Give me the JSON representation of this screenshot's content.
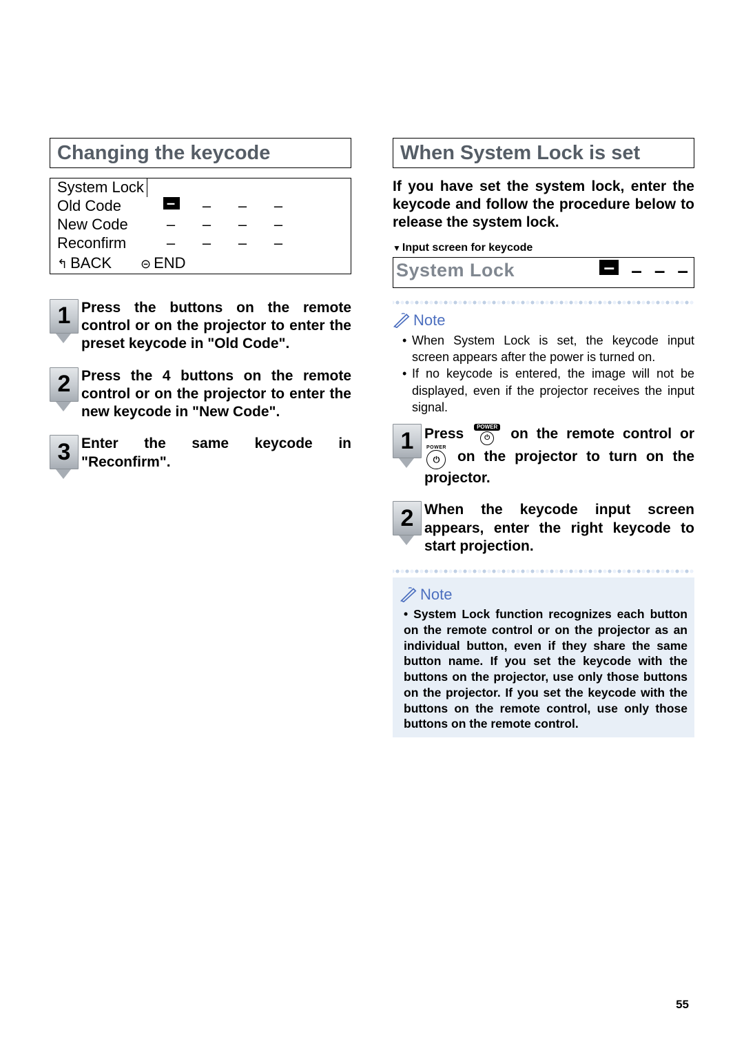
{
  "page_number": "55",
  "left": {
    "heading": "Changing the keycode",
    "osd": {
      "title": "System Lock",
      "rows": [
        {
          "label": "Old Code",
          "dashes": [
            "cursor",
            "–",
            "–",
            "–"
          ]
        },
        {
          "label": "New Code",
          "dashes": [
            "–",
            "–",
            "–",
            "–"
          ]
        },
        {
          "label": "Reconfirm",
          "dashes": [
            "–",
            "–",
            "–",
            "–"
          ]
        }
      ],
      "footer": {
        "back": "BACK",
        "end": "END"
      }
    },
    "steps": [
      {
        "n": "1",
        "text": "Press the buttons on the remote control or on the projector to enter the preset keycode in \"Old Code\"."
      },
      {
        "n": "2",
        "text": "Press the 4 buttons on the remote control or on the projector to enter the new keycode in \"New Code\"."
      },
      {
        "n": "3",
        "text": "Enter the same keycode in \"Reconfirm\"."
      }
    ]
  },
  "right": {
    "heading": "When System Lock is set",
    "intro": "If you have set the system lock, enter the keycode and follow the procedure below to release the system lock.",
    "caption": "Input screen for keycode",
    "lockbar": {
      "title": "System Lock",
      "dashes": [
        "cursor",
        "–",
        "–",
        "–"
      ]
    },
    "note1_label": "Note",
    "note1_items": [
      "When System Lock is set, the keycode input screen appears after the power is turned on.",
      "If no keycode is entered, the image will not be displayed, even if the projector receives the input signal."
    ],
    "steps": [
      {
        "n": "1",
        "pre": "Press ",
        "mid": " on the remote control or ",
        "post": " on the projector to turn on the projector.",
        "power_label": "POWER"
      },
      {
        "n": "2",
        "text": "When the keycode input screen appears, enter the right keycode to start projection."
      }
    ],
    "note2_label": "Note",
    "note2_body": "System Lock function recognizes each button on the remote control or on the projector as an individual button, even if they share the same button name. If you set the keycode with the buttons on the projector, use only those buttons on the projector. If you set the keycode with the buttons on the remote control, use only those buttons on the remote control."
  }
}
